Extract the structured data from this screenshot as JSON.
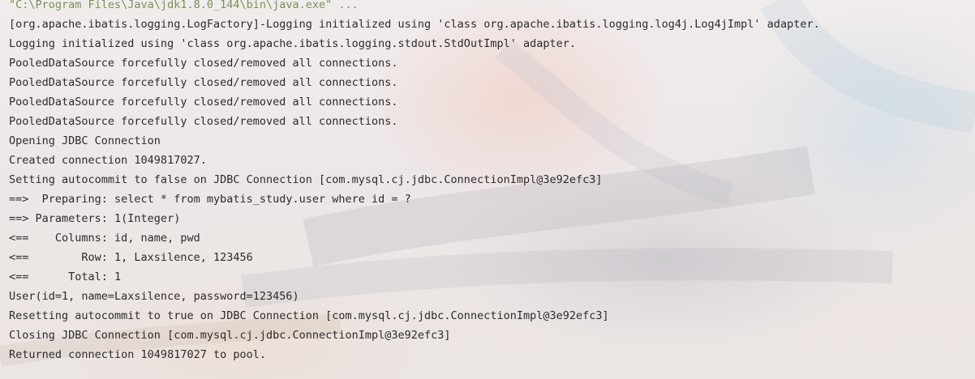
{
  "console": {
    "lines": [
      "\"C:\\Program Files\\Java\\jdk1.8.0_144\\bin\\java.exe\" ...",
      "[org.apache.ibatis.logging.LogFactory]-Logging initialized using 'class org.apache.ibatis.logging.log4j.Log4jImpl' adapter.",
      "Logging initialized using 'class org.apache.ibatis.logging.stdout.StdOutImpl' adapter.",
      "PooledDataSource forcefully closed/removed all connections.",
      "PooledDataSource forcefully closed/removed all connections.",
      "PooledDataSource forcefully closed/removed all connections.",
      "PooledDataSource forcefully closed/removed all connections.",
      "Opening JDBC Connection",
      "Created connection 1049817027.",
      "Setting autocommit to false on JDBC Connection [com.mysql.cj.jdbc.ConnectionImpl@3e92efc3]",
      "==>  Preparing: select * from mybatis_study.user where id = ?",
      "==> Parameters: 1(Integer)",
      "<==    Columns: id, name, pwd",
      "<==        Row: 1, Laxsilence, 123456",
      "<==      Total: 1",
      "User(id=1, name=Laxsilence, password=123456)",
      "Resetting autocommit to true on JDBC Connection [com.mysql.cj.jdbc.ConnectionImpl@3e92efc3]",
      "Closing JDBC Connection [com.mysql.cj.jdbc.ConnectionImpl@3e92efc3]",
      "Returned connection 1049817027 to pool."
    ]
  },
  "colors": {
    "text": "#2b2b2b",
    "command": "#7a8f5a",
    "background": "#efe9ea"
  }
}
